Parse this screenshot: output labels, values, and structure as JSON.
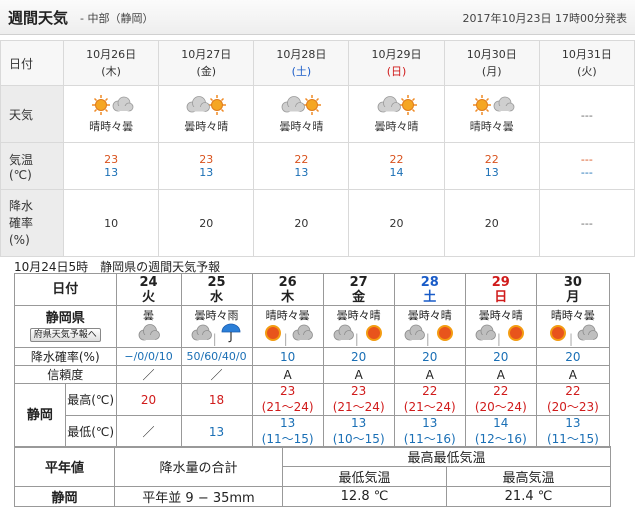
{
  "top": {
    "title": "週間天気",
    "region": "- 中部（静岡）",
    "announce": "2017年10月23日 17時00分発表",
    "labels": {
      "date": "日付",
      "weather": "天気",
      "temp1": "気温",
      "temp2": "(℃)",
      "rain1": "降水",
      "rain2": "確率",
      "rain3": "(%)"
    },
    "days": [
      {
        "date": "10月26日",
        "dow": "(木)",
        "weather": "晴時々曇",
        "icon": "sun-then-cloud-icon",
        "hi": "23",
        "lo": "13",
        "rain": "10"
      },
      {
        "date": "10月27日",
        "dow": "(金)",
        "weather": "曇時々晴",
        "icon": "cloud-then-sun-icon",
        "hi": "23",
        "lo": "13",
        "rain": "20"
      },
      {
        "date": "10月28日",
        "dow": "(土)",
        "weather": "曇時々晴",
        "icon": "cloud-then-sun-icon",
        "hi": "22",
        "lo": "13",
        "rain": "20"
      },
      {
        "date": "10月29日",
        "dow": "(日)",
        "weather": "曇時々晴",
        "icon": "cloud-then-sun-icon",
        "hi": "22",
        "lo": "14",
        "rain": "20"
      },
      {
        "date": "10月30日",
        "dow": "(月)",
        "weather": "晴時々曇",
        "icon": "sun-then-cloud-icon",
        "hi": "22",
        "lo": "13",
        "rain": "20"
      },
      {
        "date": "10月31日",
        "dow": "(火)",
        "weather": "---",
        "icon": "",
        "hi": "---",
        "lo": "---",
        "rain": "---"
      }
    ],
    "colors": {
      "hi": "#d9531e",
      "lo": "#1a6fb5",
      "saturday": "#1a5cc8",
      "sunday": "#d01b1b"
    }
  },
  "bottom": {
    "caption": "10月24日5時　静岡県の週間天気予報",
    "labels": {
      "date": "日付",
      "pref": "静岡県",
      "pref_btn": "府県天気予報へ",
      "rain": "降水確率(%)",
      "reliability": "信頼度",
      "city": "静岡",
      "max": "最高(℃)",
      "min": "最低(℃)"
    },
    "days": [
      {
        "day": "24",
        "dow": "火",
        "weather": "曇",
        "rain": "−/0/0/10",
        "rel": "／",
        "max": "20",
        "max_range": "",
        "min": "／",
        "min_range": ""
      },
      {
        "day": "25",
        "dow": "水",
        "weather": "曇時々雨",
        "rain": "50/60/40/0",
        "rel": "／",
        "max": "18",
        "max_range": "",
        "min": "13",
        "min_range": ""
      },
      {
        "day": "26",
        "dow": "木",
        "weather": "晴時々曇",
        "rain": "10",
        "rel": "A",
        "max": "23",
        "max_range": "(21〜24)",
        "min": "13",
        "min_range": "(11〜15)"
      },
      {
        "day": "27",
        "dow": "金",
        "weather": "曇時々晴",
        "rain": "20",
        "rel": "A",
        "max": "23",
        "max_range": "(21〜24)",
        "min": "13",
        "min_range": "(10〜15)"
      },
      {
        "day": "28",
        "dow": "土",
        "weather": "曇時々晴",
        "rain": "20",
        "rel": "A",
        "max": "22",
        "max_range": "(21〜24)",
        "min": "13",
        "min_range": "(11〜16)"
      },
      {
        "day": "29",
        "dow": "日",
        "weather": "曇時々晴",
        "rain": "20",
        "rel": "A",
        "max": "22",
        "max_range": "(20〜24)",
        "min": "14",
        "min_range": "(12〜16)"
      },
      {
        "day": "30",
        "dow": "月",
        "weather": "晴時々曇",
        "rain": "20",
        "rel": "A",
        "max": "22",
        "max_range": "(20〜23)",
        "min": "13",
        "min_range": "(11〜15)"
      }
    ],
    "normals": {
      "title": "平年値",
      "precip_label": "降水量の合計",
      "hilo_label": "最高最低気温",
      "min_label": "最低気温",
      "max_label": "最高気温",
      "city": "静岡",
      "precip_value": "平年並 9 − 35mm",
      "min_value": "12.8 ℃",
      "max_value": "21.4 ℃"
    }
  }
}
